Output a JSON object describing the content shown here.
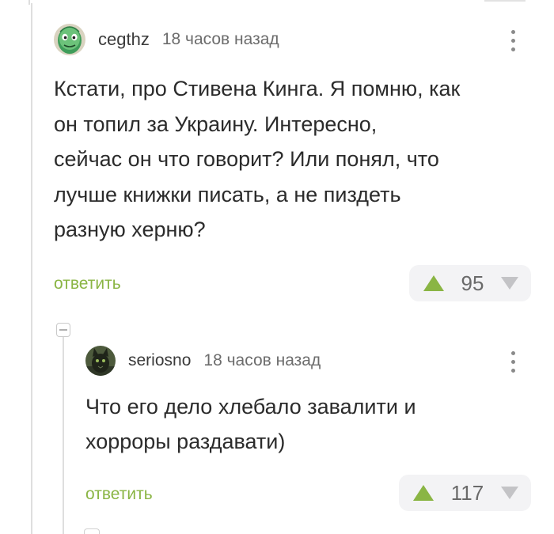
{
  "comment": {
    "username": "cegthz",
    "timestamp": "18 часов назад",
    "text": "Кстати, про Стивена Кинга. Я помню, как\nон топил за Украину. Интересно,\nсейчас он что говорит? Или понял, что\nлучше книжки писать, а не пиздеть\nразную херню?",
    "reply_label": "ответить",
    "score": "95",
    "avatar_icon": "green-alien-face-avatar",
    "menu_icon": "more-vertical-icon"
  },
  "reply": {
    "username": "seriosno",
    "timestamp": "18 часов назад",
    "text": "Что его дело хлебало завалити и\nхорроры раздавати)",
    "reply_label": "ответить",
    "score": "117",
    "avatar_icon": "dark-cat-photo-avatar",
    "menu_icon": "more-vertical-icon"
  },
  "colors": {
    "accent": "#8ab544",
    "vote_bg": "#f3f3f5",
    "downvote": "#c3c3c6",
    "thread_line": "#dedede"
  }
}
